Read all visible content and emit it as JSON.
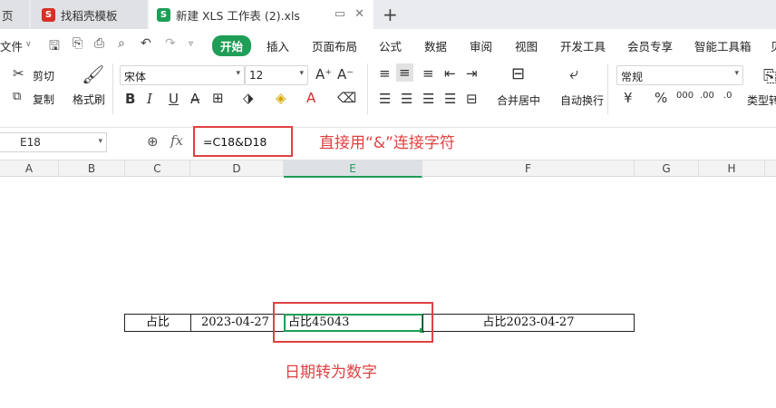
{
  "tabs": {
    "partial": "页",
    "template": "找稻壳模板",
    "file": "新建 XLS 工作表 (2).xls",
    "new_tab": "+"
  },
  "ribbon": {
    "file_menu": "文件",
    "start": "开始",
    "items": [
      "插入",
      "页面布局",
      "公式",
      "数据",
      "审阅",
      "视图",
      "开发工具",
      "会员专享",
      "智能工具箱",
      "贝"
    ]
  },
  "toolbar": {
    "cut": "剪切",
    "copy": "复制",
    "format_painter": "格式刷",
    "font_name": "宋体",
    "font_size": "12",
    "merge_center": "合并居中",
    "wrap_text": "自动换行",
    "number_format": "常规",
    "type_convert": "类型转"
  },
  "formula_bar": {
    "name_box": "E18",
    "fx": "fx",
    "formula": "=C18&D18"
  },
  "annotations": {
    "formula_note": "直接用“&”连接字符",
    "cell_note": "日期转为数字"
  },
  "columns": [
    "A",
    "B",
    "C",
    "D",
    "E",
    "F",
    "G",
    "H"
  ],
  "active_column": "E",
  "row18": {
    "C": "占比",
    "D": "2023-04-27",
    "E": "占比45043",
    "F": "占比2023-04-27"
  },
  "colors": {
    "accent_green": "#1e9e57",
    "annotation_red": "#e04141"
  }
}
